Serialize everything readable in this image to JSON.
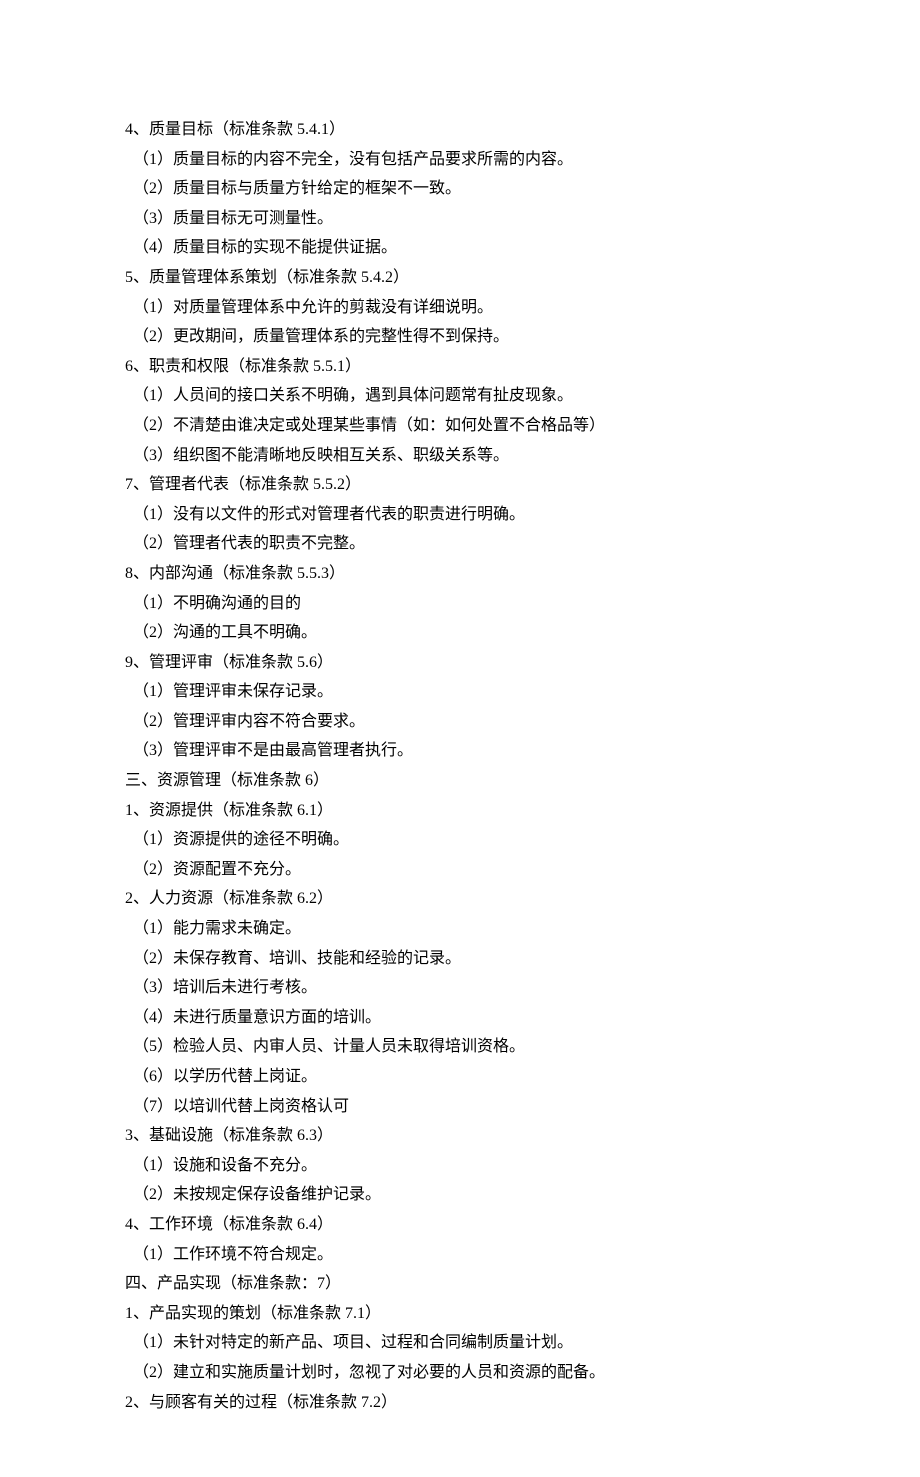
{
  "lines": [
    {
      "text": "4、质量目标（标准条款 5.4.1）",
      "indent": false
    },
    {
      "text": "（1）质量目标的内容不完全，没有包括产品要求所需的内容。",
      "indent": true
    },
    {
      "text": "（2）质量目标与质量方针给定的框架不一致。",
      "indent": true
    },
    {
      "text": "（3）质量目标无可测量性。",
      "indent": true
    },
    {
      "text": "（4）质量目标的实现不能提供证据。",
      "indent": true
    },
    {
      "text": "5、质量管理体系策划（标准条款 5.4.2）",
      "indent": false
    },
    {
      "text": "（1）对质量管理体系中允许的剪裁没有详细说明。",
      "indent": true
    },
    {
      "text": "（2）更改期间，质量管理体系的完整性得不到保持。",
      "indent": true
    },
    {
      "text": "6、职责和权限（标准条款 5.5.1）",
      "indent": false
    },
    {
      "text": "（1）人员间的接口关系不明确，遇到具体问题常有扯皮现象。",
      "indent": true
    },
    {
      "text": "（2）不清楚由谁决定或处理某些事情（如：如何处置不合格品等）",
      "indent": true
    },
    {
      "text": "（3）组织图不能清晰地反映相互关系、职级关系等。",
      "indent": true
    },
    {
      "text": "7、管理者代表（标准条款 5.5.2）",
      "indent": false
    },
    {
      "text": "（1）没有以文件的形式对管理者代表的职责进行明确。",
      "indent": true
    },
    {
      "text": "（2）管理者代表的职责不完整。",
      "indent": true
    },
    {
      "text": "8、内部沟通（标准条款 5.5.3）",
      "indent": false
    },
    {
      "text": "（1）不明确沟通的目的",
      "indent": true
    },
    {
      "text": "（2）沟通的工具不明确。",
      "indent": true
    },
    {
      "text": "9、管理评审（标准条款 5.6）",
      "indent": false
    },
    {
      "text": "（1）管理评审未保存记录。",
      "indent": true
    },
    {
      "text": "（2）管理评审内容不符合要求。",
      "indent": true
    },
    {
      "text": "（3）管理评审不是由最高管理者执行。",
      "indent": true
    },
    {
      "text": "三、资源管理（标准条款 6）",
      "indent": false
    },
    {
      "text": "1、资源提供（标准条款 6.1）",
      "indent": false
    },
    {
      "text": "（1）资源提供的途径不明确。",
      "indent": true
    },
    {
      "text": "（2）资源配置不充分。",
      "indent": true
    },
    {
      "text": "2、人力资源（标准条款 6.2）",
      "indent": false
    },
    {
      "text": "（1）能力需求未确定。",
      "indent": true
    },
    {
      "text": "（2）未保存教育、培训、技能和经验的记录。",
      "indent": true
    },
    {
      "text": "（3）培训后未进行考核。",
      "indent": true
    },
    {
      "text": "（4）未进行质量意识方面的培训。",
      "indent": true
    },
    {
      "text": "（5）检验人员、内审人员、计量人员未取得培训资格。",
      "indent": true
    },
    {
      "text": "（6）以学历代替上岗证。",
      "indent": true
    },
    {
      "text": "（7）以培训代替上岗资格认可",
      "indent": true
    },
    {
      "text": "3、基础设施（标准条款 6.3）",
      "indent": false
    },
    {
      "text": "（1）设施和设备不充分。",
      "indent": true
    },
    {
      "text": "（2）未按规定保存设备维护记录。",
      "indent": true
    },
    {
      "text": "4、工作环境（标准条款 6.4）",
      "indent": false
    },
    {
      "text": "（1）工作环境不符合规定。",
      "indent": true
    },
    {
      "text": "四、产品实现（标准条款：7）",
      "indent": false
    },
    {
      "text": "1、产品实现的策划（标准条款 7.1）",
      "indent": false
    },
    {
      "text": "（1）未针对特定的新产品、项目、过程和合同编制质量计划。",
      "indent": true
    },
    {
      "text": "（2）建立和实施质量计划时，忽视了对必要的人员和资源的配备。",
      "indent": true
    },
    {
      "text": "2、与顾客有关的过程（标准条款 7.2）",
      "indent": false
    }
  ]
}
